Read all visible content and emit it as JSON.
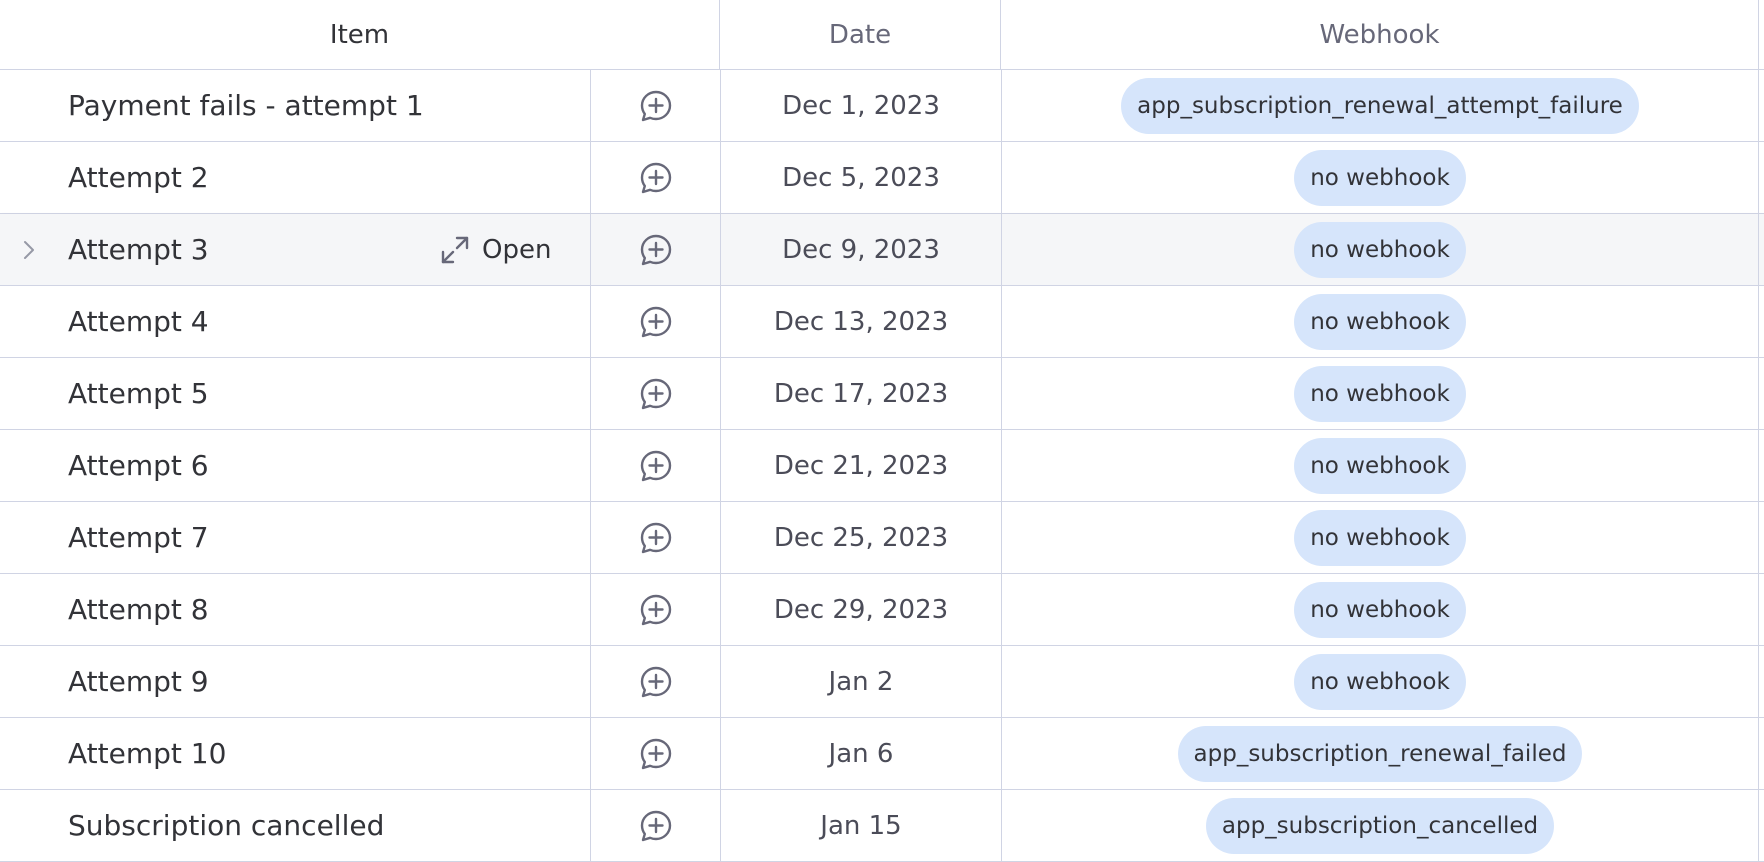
{
  "columns": {
    "item": "Item",
    "date": "Date",
    "webhook": "Webhook"
  },
  "open_label": "Open",
  "icons": {
    "add_update": "add-update-icon",
    "expand": "expand-icon",
    "chevron": "chevron-right-icon"
  },
  "colors": {
    "pill_bg": "#d6e5fb",
    "border": "#d0d4e4",
    "hover_row": "#f5f6f8"
  },
  "rows": [
    {
      "name": "Payment fails - attempt 1",
      "date": "Dec 1, 2023",
      "webhook": "app_subscription_renewal_attempt_failure"
    },
    {
      "name": "Attempt 2",
      "date": "Dec 5, 2023",
      "webhook": "no webhook"
    },
    {
      "name": "Attempt 3",
      "date": "Dec 9, 2023",
      "webhook": "no webhook"
    },
    {
      "name": "Attempt 4",
      "date": "Dec 13, 2023",
      "webhook": "no webhook"
    },
    {
      "name": "Attempt 5",
      "date": "Dec 17, 2023",
      "webhook": "no webhook"
    },
    {
      "name": "Attempt 6",
      "date": "Dec 21, 2023",
      "webhook": "no webhook"
    },
    {
      "name": "Attempt 7",
      "date": "Dec 25, 2023",
      "webhook": "no webhook"
    },
    {
      "name": "Attempt 8",
      "date": "Dec 29, 2023",
      "webhook": "no webhook"
    },
    {
      "name": "Attempt 9",
      "date": "Jan 2",
      "webhook": "no webhook"
    },
    {
      "name": "Attempt 10",
      "date": "Jan 6",
      "webhook": "app_subscription_renewal_failed"
    },
    {
      "name": "Subscription cancelled",
      "date": "Jan 15",
      "webhook": "app_subscription_cancelled"
    }
  ]
}
